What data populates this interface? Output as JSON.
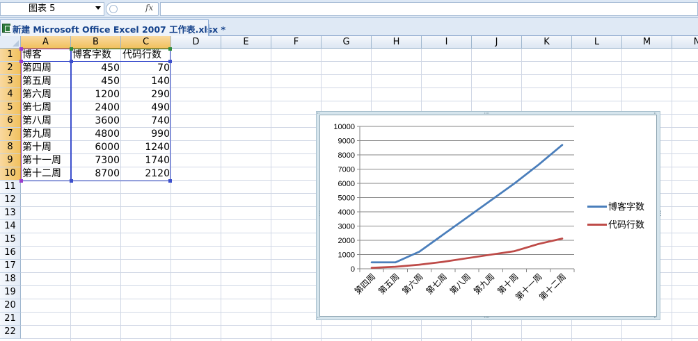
{
  "formula_bar": {
    "name_box": "图表 5",
    "fx": "fx",
    "formula": ""
  },
  "workbook": {
    "title": "新建 Microsoft Office Excel 2007 工作表.xlsx *"
  },
  "sheet": {
    "columns": [
      "A",
      "B",
      "C",
      "D",
      "E",
      "F",
      "G",
      "H",
      "I",
      "J",
      "K",
      "L",
      "M",
      "N"
    ],
    "rows": [
      "1",
      "2",
      "3",
      "4",
      "5",
      "6",
      "7",
      "8",
      "9",
      "10",
      "11",
      "12",
      "13",
      "14",
      "15",
      "16",
      "17",
      "18",
      "19",
      "20",
      "21",
      "22"
    ],
    "headers": [
      "博客",
      "博客字数",
      "代码行数"
    ],
    "data": [
      [
        "第四周",
        "450",
        "70"
      ],
      [
        "第五周",
        "450",
        "140"
      ],
      [
        "第六周",
        "1200",
        "290"
      ],
      [
        "第七周",
        "2400",
        "490"
      ],
      [
        "第八周",
        "3600",
        "740"
      ],
      [
        "第九周",
        "4800",
        "990"
      ],
      [
        "第十周",
        "6000",
        "1240"
      ],
      [
        "第十一周",
        "7300",
        "1740"
      ],
      [
        "第十二周",
        "8700",
        "2120"
      ]
    ]
  },
  "chart_data": {
    "type": "line",
    "categories": [
      "第四周",
      "第五周",
      "第六周",
      "第七周",
      "第八周",
      "第九周",
      "第十周",
      "第十一周",
      "第十二周"
    ],
    "series": [
      {
        "name": "博客字数",
        "values": [
          450,
          450,
          1200,
          2400,
          3600,
          4800,
          6000,
          7300,
          8700
        ],
        "color": "#4a7ebb"
      },
      {
        "name": "代码行数",
        "values": [
          70,
          140,
          290,
          490,
          740,
          990,
          1240,
          1740,
          2120
        ],
        "color": "#be4b48"
      }
    ],
    "ylim": [
      0,
      10000
    ],
    "yticks": [
      0,
      1000,
      2000,
      3000,
      4000,
      5000,
      6000,
      7000,
      8000,
      9000,
      10000
    ],
    "grid": true,
    "legend": "right"
  },
  "colors": {
    "selection_blue": "#3c4fcc",
    "selection_purple": "#9a3ccc",
    "selection_green": "#2e8b3e",
    "header_highlight": "#f1c15f"
  }
}
